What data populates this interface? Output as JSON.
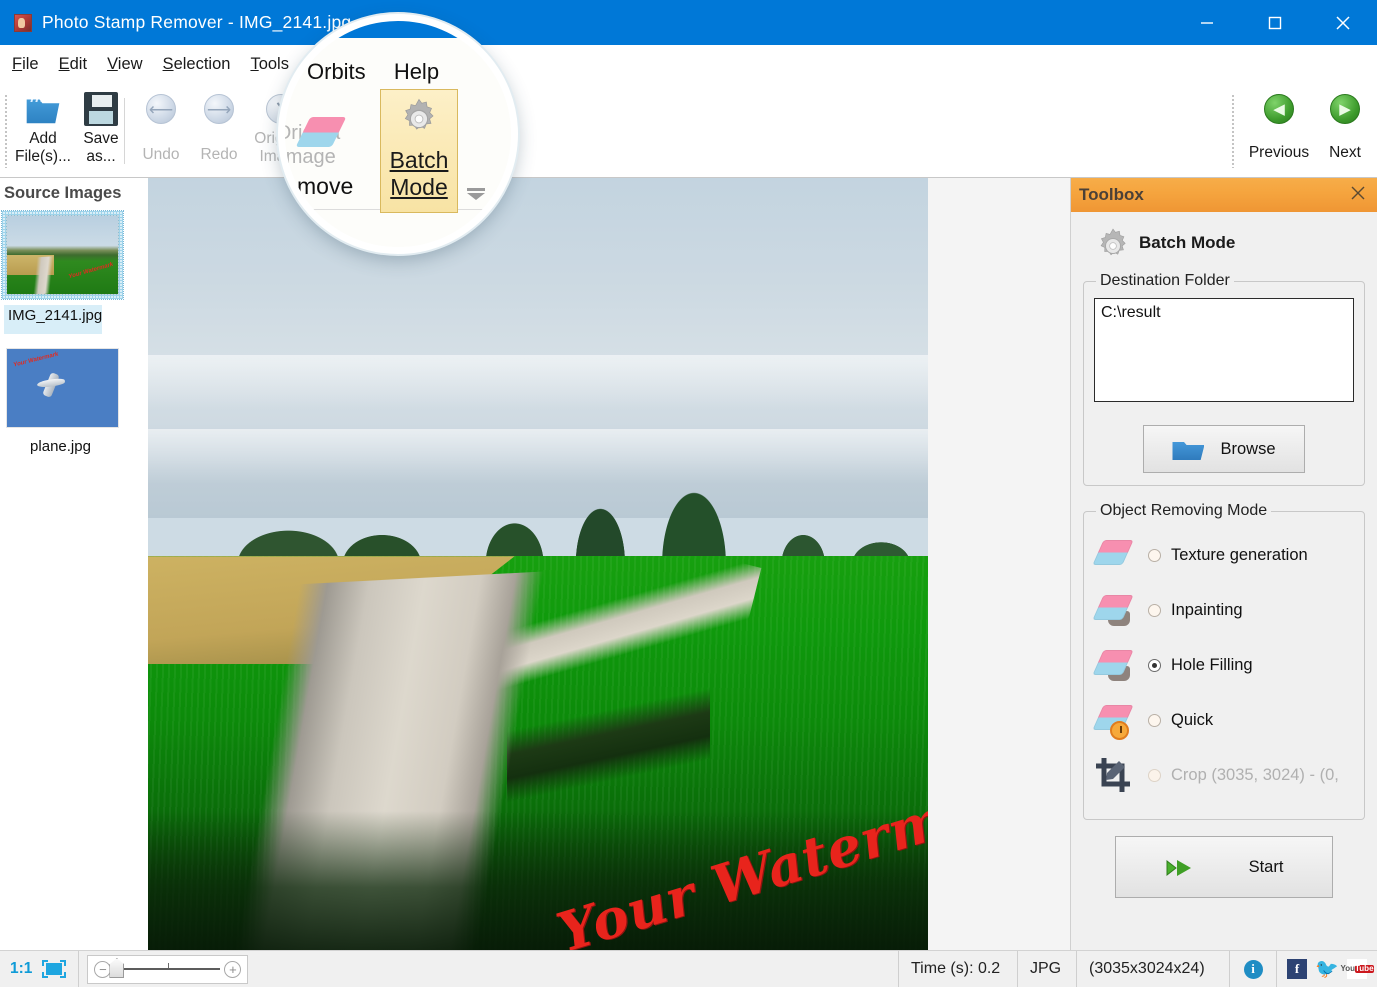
{
  "window": {
    "title": "Photo Stamp Remover - IMG_2141.jpg",
    "icon": "app-icon",
    "minimize": "–",
    "maximize": "□",
    "close": "✕"
  },
  "menubar": {
    "items": [
      {
        "label": "File",
        "accel": "F"
      },
      {
        "label": "Edit",
        "accel": "E"
      },
      {
        "label": "View",
        "accel": "V"
      },
      {
        "label": "Selection",
        "accel": "S"
      },
      {
        "label": "Tools",
        "accel": "T"
      }
    ]
  },
  "ribbon": {
    "buttons": [
      {
        "name": "add-files",
        "label_line1": "Add",
        "label_line2": "File(s)...",
        "icon": "folder-open-icon",
        "enabled": true
      },
      {
        "name": "save-as",
        "label_line1": "Save",
        "label_line2": "as...",
        "icon": "floppy-disk-icon",
        "enabled": true
      },
      {
        "name": "undo",
        "label_line1": "Undo",
        "label_line2": "",
        "icon": "undo-arrow-icon",
        "enabled": false
      },
      {
        "name": "redo",
        "label_line1": "Redo",
        "label_line2": "",
        "icon": "redo-arrow-icon",
        "enabled": false
      },
      {
        "name": "original-image",
        "label_line1": "Original",
        "label_line2": "Image",
        "icon": "clock-icon",
        "enabled": false
      }
    ],
    "nav": [
      {
        "name": "previous",
        "label": "Previous",
        "icon": "arrow-left-circle-icon"
      },
      {
        "name": "next",
        "label": "Next",
        "icon": "arrow-right-circle-icon"
      }
    ]
  },
  "magnifier": {
    "menu_items": [
      "Orbits",
      "Help"
    ],
    "remove_partial": "move",
    "original_image_line1": "Origina",
    "original_image_line2": "Image",
    "batch_line1": "Batch",
    "batch_line2": "Mode",
    "icon": "gear-icon",
    "eraser_icon": "eraser-icon",
    "dropdown_icon": "chevron-down-icon"
  },
  "source_images": {
    "title": "Source Images",
    "items": [
      {
        "filename": "IMG_2141.jpg",
        "selected": true,
        "thumb": "landscape-road-thumbnail",
        "watermark": "Your Watermark"
      },
      {
        "filename": "plane.jpg",
        "selected": false,
        "thumb": "airplane-thumbnail",
        "watermark": "Your Watermark"
      }
    ]
  },
  "canvas": {
    "image_name": "IMG_2141.jpg",
    "watermark_text": "Your Watermark",
    "watermark_color": "#e8241c"
  },
  "toolbox": {
    "header_title": "Toolbox",
    "close_icon": "close-icon",
    "accent_color": "#f5a43e",
    "mode_title": "Batch Mode",
    "mode_icon": "gear-icon",
    "destination": {
      "legend": "Destination Folder",
      "value": "C:\\result",
      "placeholder": "",
      "browse_label": "Browse",
      "browse_icon": "folder-icon"
    },
    "object_removing_mode": {
      "legend": "Object Removing Mode",
      "options": [
        {
          "label": "Texture generation",
          "selected": false,
          "enabled": true,
          "icon": "eraser-icon"
        },
        {
          "label": "Inpainting",
          "selected": false,
          "enabled": true,
          "icon": "eraser-shadow-icon"
        },
        {
          "label": "Hole Filling",
          "selected": true,
          "enabled": true,
          "icon": "eraser-shadow-icon"
        },
        {
          "label": "Quick",
          "selected": false,
          "enabled": true,
          "icon": "eraser-clock-icon"
        },
        {
          "label": "Crop (3035, 3024) - (0,",
          "selected": false,
          "enabled": false,
          "icon": "crop-icon"
        }
      ]
    },
    "start_label": "Start",
    "start_icon": "green-arrow-icon"
  },
  "statusbar": {
    "zoom_ratio": "1:1",
    "fit_icon": "fit-to-screen-icon",
    "zoom_out_icon": "minus-icon",
    "zoom_in_icon": "plus-icon",
    "time": "Time (s): 0.2",
    "format": "JPG",
    "dimensions": "(3035x3024x24)",
    "info_icon": "info-icon",
    "social": [
      {
        "name": "facebook-icon",
        "glyph": "f"
      },
      {
        "name": "twitter-icon",
        "glyph": "🐦"
      },
      {
        "name": "youtube-icon",
        "glyph": "You"
      }
    ],
    "youtube_line1": "You",
    "youtube_line2": "Tube"
  }
}
